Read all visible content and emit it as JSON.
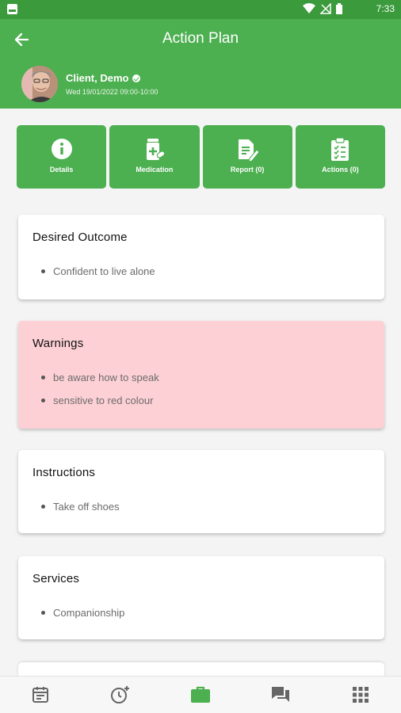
{
  "status_bar": {
    "time": "7:33",
    "icons": [
      "photo-icon",
      "wifi-icon",
      "no-signal-icon",
      "battery-icon"
    ]
  },
  "header": {
    "title": "Action Plan",
    "back_icon": "arrow-left-icon"
  },
  "client": {
    "name": "Client, Demo",
    "date": "Wed 19/01/2022 09:00-10:00"
  },
  "tiles": [
    {
      "label": "Details",
      "icon": "info-icon"
    },
    {
      "label": "Medication",
      "icon": "medication-icon"
    },
    {
      "label": "Report (0)",
      "icon": "report-icon"
    },
    {
      "label": "Actions (0)",
      "icon": "clipboard-check-icon"
    }
  ],
  "sections": {
    "desired_outcome": {
      "title": "Desired Outcome",
      "items": [
        "Confident to live alone"
      ]
    },
    "warnings": {
      "title": "Warnings",
      "items": [
        "be aware how to speak",
        "sensitive to red colour"
      ]
    },
    "instructions": {
      "title": "Instructions",
      "items": [
        "Take off shoes"
      ]
    },
    "services": {
      "title": "Services",
      "items": [
        "Companionship"
      ]
    }
  },
  "bottom_nav": [
    {
      "icon": "calendar-icon",
      "active": false
    },
    {
      "icon": "clock-add-icon",
      "active": false
    },
    {
      "icon": "briefcase-icon",
      "active": true
    },
    {
      "icon": "chat-icon",
      "active": false
    },
    {
      "icon": "grid-icon",
      "active": false
    }
  ],
  "colors": {
    "primary": "#4caf50",
    "status_bar": "#3a9a3c",
    "warning_bg": "#fdd0d5",
    "inactive_icon": "#666666"
  }
}
